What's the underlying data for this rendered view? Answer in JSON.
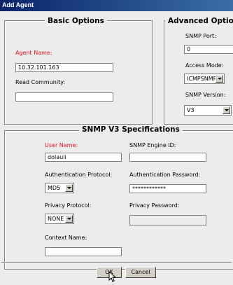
{
  "window": {
    "title": "Add Agent"
  },
  "basic": {
    "legend": "Basic Options",
    "agent_name_label": "Agent Name:",
    "agent_name_value": "10.32.101.163",
    "read_community_label": "Read Community:",
    "read_community_value": ""
  },
  "advanced": {
    "legend": "Advanced Options",
    "snmp_port_label": "SNMP Port:",
    "snmp_port_value": "0",
    "access_mode_label": "Access Mode:",
    "access_mode_value": "ICMPSNMP",
    "snmp_version_label": "SNMP Version:",
    "snmp_version_value": "V3"
  },
  "v3": {
    "legend": "SNMP V3 Specifications",
    "user_name_label": "User Name:",
    "user_name_value": "dolauli",
    "engine_id_label": "SNMP Engine ID:",
    "engine_id_value": "",
    "auth_protocol_label": "Authentication Protocol:",
    "auth_protocol_value": "MD5",
    "auth_password_label": "Authentication Password:",
    "auth_password_value": "************",
    "privacy_protocol_label": "Privacy Protocol:",
    "privacy_protocol_value": "NONE",
    "privacy_password_label": "Privacy Password:",
    "privacy_password_value": "",
    "context_name_label": "Context Name:",
    "context_name_value": ""
  },
  "buttons": {
    "ok": "OK",
    "cancel": "Cancel"
  },
  "colors": {
    "required_label": "#e0141e",
    "title_bar": "#0a246a"
  }
}
